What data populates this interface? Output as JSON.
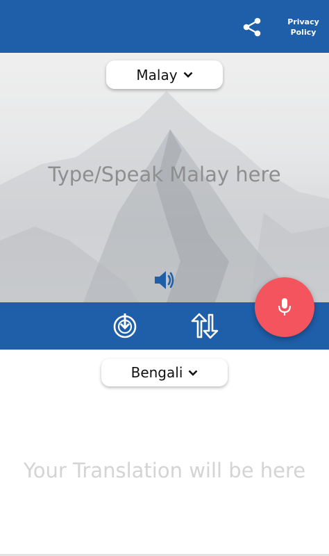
{
  "header": {
    "share_icon": "share-icon",
    "privacy_line1": "Privacy",
    "privacy_line2": "Policy",
    "color": "#1f5ea8"
  },
  "source": {
    "language": "Malay",
    "placeholder": "Type/Speak Malay here",
    "value": "",
    "speaker_icon": "volume-icon"
  },
  "toolbar": {
    "download_icon": "download-circle-icon",
    "swap_icon": "swap-arrows-icon",
    "mic_icon": "microphone-icon",
    "mic_color": "#f4545e"
  },
  "target": {
    "language": "Bengali",
    "placeholder": "Your Translation will be here"
  }
}
